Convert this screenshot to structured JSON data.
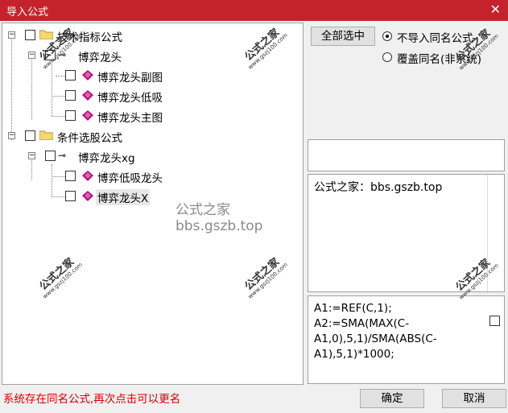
{
  "window": {
    "title": "导入公式",
    "close_glyph": "✕"
  },
  "tree": {
    "nodes": [
      {
        "label": "技术指标公式",
        "type": "folder"
      },
      {
        "label": "博弈龙头",
        "type": "key"
      },
      {
        "label": "博弈龙头副图",
        "type": "gem"
      },
      {
        "label": "博弈龙头低吸",
        "type": "gem"
      },
      {
        "label": "博弈龙头主图",
        "type": "gem"
      },
      {
        "label": "条件选股公式",
        "type": "folder"
      },
      {
        "label": "博弈龙头xg",
        "type": "key"
      },
      {
        "label": "博弈低吸龙头",
        "type": "gem"
      },
      {
        "label": "博弈龙头X",
        "type": "gem"
      }
    ]
  },
  "watermark": {
    "center_text": "公式之家 bbs.gszb.top",
    "stamp_big": "公式之家",
    "stamp_small": "www.gszj100.com"
  },
  "options": {
    "select_all_label": "全部选中",
    "radio_skip_label": "不导入同名公式",
    "radio_overwrite_label": "覆盖同名(非系统)"
  },
  "info": {
    "text": "公式之家：bbs.gszb.top"
  },
  "formula": {
    "text": "A1:=REF(C,1);\nA2:=SMA(MAX(C-\nA1,0),5,1)/SMA(ABS(C-\nA1),5,1)*1000;"
  },
  "status": {
    "message": "系统存在同名公式,再次点击可以更名"
  },
  "buttons": {
    "ok_label": "确定",
    "cancel_label": "取消"
  },
  "colors": {
    "titlebar": "#c5232b",
    "status_text": "#e00000",
    "gem": "#b0127a",
    "folder": "#f5d76e"
  },
  "icons": {
    "folder": "folder-icon",
    "gem": "formula-gem-icon",
    "key": "key-icon",
    "close": "close-icon"
  }
}
